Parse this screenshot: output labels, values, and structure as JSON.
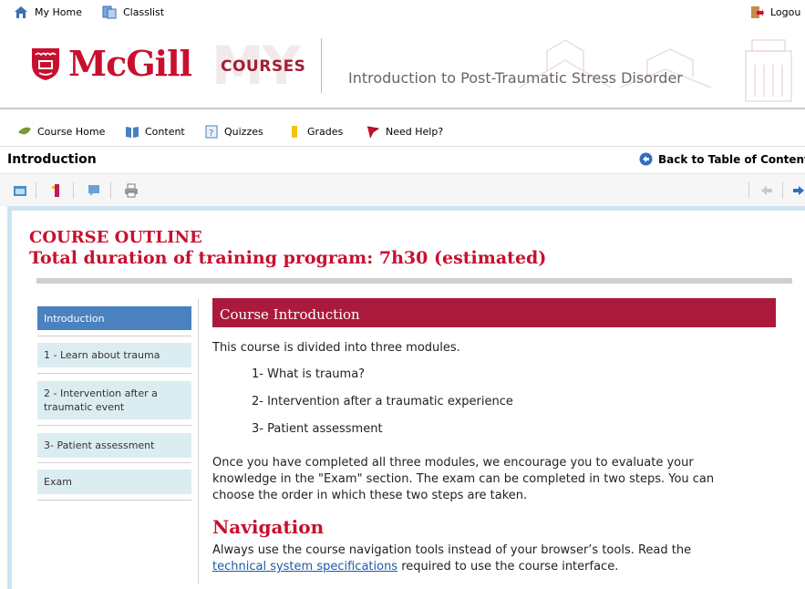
{
  "toplinks": {
    "home": "My Home",
    "classlist": "Classlist",
    "logout": "Logou"
  },
  "header": {
    "brand": "McGill",
    "courses_mark": "COURSES",
    "my_mark": "MY",
    "course_title": "Introduction to Post-Traumatic Stress Disorder"
  },
  "nav": {
    "course_home": "Course Home",
    "content": "Content",
    "quizzes": "Quizzes",
    "grades": "Grades",
    "need_help": "Need Help?"
  },
  "page": {
    "heading": "Introduction",
    "back_link": "Back to Table of Contents"
  },
  "outline": {
    "title": "COURSE OUTLINE",
    "subtitle": "Total duration of training program: 7h30 (estimated)"
  },
  "menu": {
    "items": [
      {
        "label": "Introduction"
      },
      {
        "label": "1 - Learn about trauma"
      },
      {
        "label": "2 - Intervention after a traumatic event"
      },
      {
        "label": "3- Patient assessment"
      },
      {
        "label": "Exam"
      }
    ]
  },
  "main": {
    "section_title": "Course Introduction",
    "intro": "This course is divided into three modules.",
    "modules": [
      "1- What is trauma?",
      "2- Intervention after a traumatic experience",
      "3- Patient assessment"
    ],
    "paragraph_line1": "Once you have completed all three modules, we encourage you to evaluate your",
    "paragraph_line2": "knowledge in the \"Exam\" section.  The exam can be completed in two steps.  You can",
    "paragraph_line3": "choose the order in which these two steps are taken.",
    "navigation_heading": "Navigation",
    "nav_text": "Always use the course navigation tools instead of your browser’s tools. Read the",
    "nav_link": "technical system specifications",
    "nav_text_end": " required to use the course interface."
  },
  "colors": {
    "brand_red": "#c8102e",
    "section_bar": "#ab1a3c",
    "menu_active": "#4a81bf",
    "menu_bg": "#dcedf2"
  }
}
